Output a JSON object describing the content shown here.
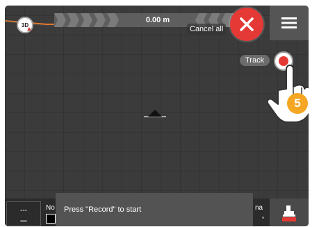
{
  "toolbar": {
    "view_mode_label": "3D",
    "distance_text": "0.00 m",
    "cancel_label": "Cancel all"
  },
  "track": {
    "label": "Track"
  },
  "instruction": {
    "step_number": "5"
  },
  "status_bar": {
    "speed_text": "---",
    "left_label_partial": "No",
    "message": "Press \"Record\" to start",
    "right_label_partial": "na"
  },
  "colors": {
    "record_red": "#e53935",
    "step_badge": "#f5a623",
    "field_boundary": "#e07a2f",
    "background": "#3b3b3b"
  },
  "icons": {
    "view_mode": "3d-view-icon",
    "cancel": "close-icon",
    "menu": "hamburger-menu-icon",
    "record": "record-icon",
    "vehicle": "vehicle-marker-icon",
    "tractor": "tractor-icon",
    "hand": "pointing-hand-icon"
  }
}
